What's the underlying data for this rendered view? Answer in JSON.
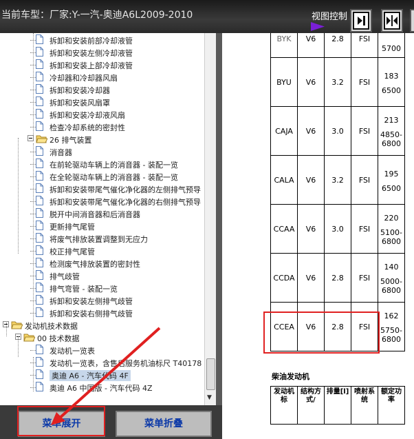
{
  "title": {
    "text": "当前车型：厂家:Y-一汽-奥迪A6L2009-2010",
    "view_control": "视图控制"
  },
  "tree": [
    {
      "label": "拆卸和安装前部冷却液管",
      "indent": 3
    },
    {
      "label": "拆卸和安装左侧冷却液管",
      "indent": 3
    },
    {
      "label": "拆卸和安装上部冷却液管",
      "indent": 3
    },
    {
      "label": "冷却器和冷却器风扇",
      "indent": 3
    },
    {
      "label": "拆卸和安装冷却器",
      "indent": 3
    },
    {
      "label": "拆卸和安装风扇罩",
      "indent": 3
    },
    {
      "label": "拆卸和安装冷却液风扇",
      "indent": 3
    },
    {
      "label": "检查冷却系统的密封性",
      "indent": 3
    },
    {
      "label": "26 排气装置",
      "indent": 2,
      "folder": true
    },
    {
      "label": "消音器",
      "indent": 3
    },
    {
      "label": "在前轮驱动车辆上的消音器 - 装配一览",
      "indent": 3
    },
    {
      "label": "在全轮驱动车辆上的消音器 - 装配一览",
      "indent": 3
    },
    {
      "label": "拆卸和安装带尾气催化净化器的左侧排气预导",
      "indent": 3
    },
    {
      "label": "拆卸和安装带尾气催化净化器的右侧排气预导",
      "indent": 3
    },
    {
      "label": "脱开中间消音器和后消音器",
      "indent": 3
    },
    {
      "label": "更新排气尾管",
      "indent": 3
    },
    {
      "label": "将废气排放装置调整到无应力",
      "indent": 3
    },
    {
      "label": "校正排气尾管",
      "indent": 3
    },
    {
      "label": "检测废气排放装置的密封性",
      "indent": 3
    },
    {
      "label": "排气歧管",
      "indent": 3
    },
    {
      "label": "排气弯管 - 装配一览",
      "indent": 3
    },
    {
      "label": "拆卸和安装左侧排气歧管",
      "indent": 3
    },
    {
      "label": "拆卸和安装右侧排气歧管",
      "indent": 3
    },
    {
      "label": "发动机技术数据",
      "indent": 0,
      "folder": true
    },
    {
      "label": "00 技术数据",
      "indent": 1,
      "folder": true
    },
    {
      "label": "发动机一览表",
      "indent": 3
    },
    {
      "label": "发动机一览表，含售后服务机油标尺 T40178",
      "indent": 3
    },
    {
      "label": "奥迪 A6 - 汽车代码 4F",
      "indent": 3,
      "selected": true
    },
    {
      "label": "奥迪 A6 中国版 - 汽车代码 4Z",
      "indent": 3
    }
  ],
  "engine_table": [
    {
      "code": "BYK",
      "cyl": "V6",
      "disp": "2.8",
      "inj": "FSI",
      "power": "5700",
      "partial": true
    },
    {
      "code": "BYU",
      "cyl": "V6",
      "disp": "3.2",
      "inj": "FSI",
      "power": "183",
      "rpm": "6500"
    },
    {
      "code": "CAJA",
      "cyl": "V6",
      "disp": "3.0",
      "inj": "FSI",
      "power": "213",
      "rpm": "4850-6800"
    },
    {
      "code": "CALA",
      "cyl": "V6",
      "disp": "3.2",
      "inj": "FSI",
      "power": "195",
      "rpm": "6500"
    },
    {
      "code": "CCAA",
      "cyl": "V6",
      "disp": "3.0",
      "inj": "FSI",
      "power": "220",
      "rpm": "5100-6800"
    },
    {
      "code": "CCDA",
      "cyl": "V6",
      "disp": "2.8",
      "inj": "FSI",
      "power": "140",
      "rpm": "5000-6800"
    },
    {
      "code": "CCEA",
      "cyl": "V6",
      "disp": "2.8",
      "inj": "FSI",
      "power": "162",
      "rpm": "5750-6800"
    }
  ],
  "diesel": {
    "title": "柴油发动机",
    "headers": [
      "发动机标",
      "结构方式/",
      "排量[l]",
      "喷射系统",
      "额定功率"
    ]
  },
  "buttons": {
    "expand": "菜单展开",
    "collapse": "菜单折叠"
  },
  "colors": {
    "highlight": "#e02020",
    "button_text": "#0d3aa8"
  }
}
